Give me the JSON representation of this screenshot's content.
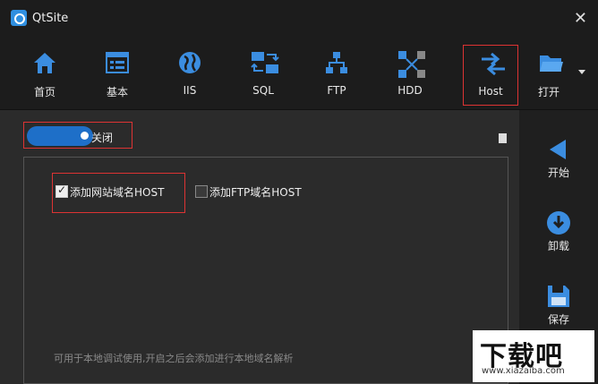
{
  "window": {
    "title": "QtSite"
  },
  "toolbar": {
    "items": [
      {
        "label": "首页",
        "icon": "home-icon"
      },
      {
        "label": "基本",
        "icon": "settings-panel-icon"
      },
      {
        "label": "IIS",
        "icon": "globe-icon"
      },
      {
        "label": "SQL",
        "icon": "database-sync-icon"
      },
      {
        "label": "FTP",
        "icon": "network-icon"
      },
      {
        "label": "HDD",
        "icon": "hdd-icon"
      },
      {
        "label": "Host",
        "icon": "swap-arrows-icon"
      },
      {
        "label": "打开",
        "icon": "folder-icon"
      }
    ]
  },
  "toggle": {
    "label": "关闭"
  },
  "options": {
    "web_host": {
      "label": "添加网站域名HOST",
      "checked": true
    },
    "ftp_host": {
      "label": "添加FTP域名HOST",
      "checked": false
    }
  },
  "hint": "可用于本地调试使用,开启之后会添加进行本地域名解析",
  "sidebar": {
    "start": "开始",
    "uninstall": "卸载",
    "save": "保存"
  },
  "watermark": {
    "text": "下载吧",
    "sub": "www.xiazaiba.com"
  },
  "colors": {
    "accent": "#1e6fc8",
    "highlight": "#d33333",
    "icon_blue": "#3b8de0"
  }
}
